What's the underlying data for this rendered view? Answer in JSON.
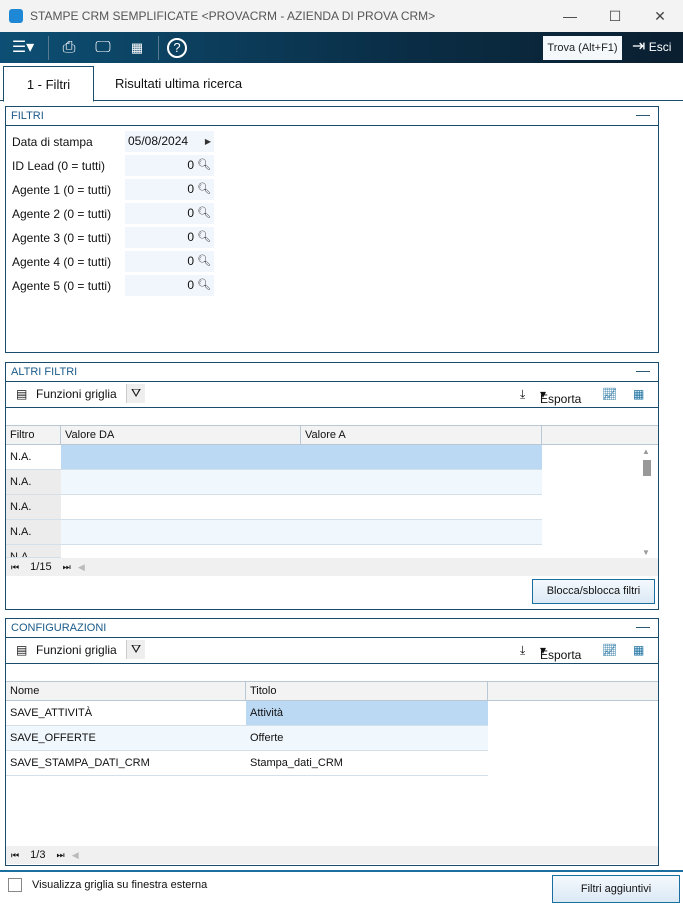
{
  "window": {
    "title": "STAMPE CRM SEMPLIFICATE <PROVACRM - AZIENDA DI PROVA CRM>",
    "minimize": "—",
    "maximize": "☐",
    "close": "✕"
  },
  "toolbar": {
    "find": "Trova (Alt+F1)",
    "exit": "Esci"
  },
  "tabs": [
    {
      "label": "1 - Filtri"
    },
    {
      "label": "Risultati ultima ricerca"
    }
  ],
  "filtri": {
    "title": "FILTRI",
    "rows": [
      {
        "label": "Data di stampa",
        "value": "05/08/2024"
      },
      {
        "label": "ID Lead (0 = tutti)",
        "value": "0"
      },
      {
        "label": "Agente 1 (0 = tutti)",
        "value": "0"
      },
      {
        "label": "Agente 2 (0 = tutti)",
        "value": "0"
      },
      {
        "label": "Agente 3 (0 = tutti)",
        "value": "0"
      },
      {
        "label": "Agente 4 (0 = tutti)",
        "value": "0"
      },
      {
        "label": "Agente 5 (0 = tutti)",
        "value": "0"
      }
    ]
  },
  "altri": {
    "title": "ALTRI FILTRI",
    "grid_functions": "Funzioni griglia",
    "export": "Esporta",
    "columns": [
      "Filtro",
      "Valore DA",
      "Valore A"
    ],
    "rows": [
      [
        "N.A.",
        "",
        ""
      ],
      [
        "N.A.",
        "",
        ""
      ],
      [
        "N.A.",
        "",
        ""
      ],
      [
        "N.A.",
        "",
        ""
      ],
      [
        "N.A.",
        "",
        ""
      ]
    ],
    "pager": "1/15",
    "lock_button": "Blocca/sblocca filtri"
  },
  "config": {
    "title": "CONFIGURAZIONI",
    "grid_functions": "Funzioni griglia",
    "export": "Esporta",
    "columns": [
      "Nome",
      "Titolo"
    ],
    "rows": [
      [
        "SAVE_ATTIVITÀ",
        "Attività"
      ],
      [
        "SAVE_OFFERTE",
        "Offerte"
      ],
      [
        "SAVE_STAMPA_DATI_CRM",
        "Stampa_dati_CRM"
      ]
    ],
    "pager": "1/3"
  },
  "footer": {
    "checkbox_label": "Visualizza griglia su finestra esterna",
    "more_filters": "Filtri aggiuntivi"
  }
}
